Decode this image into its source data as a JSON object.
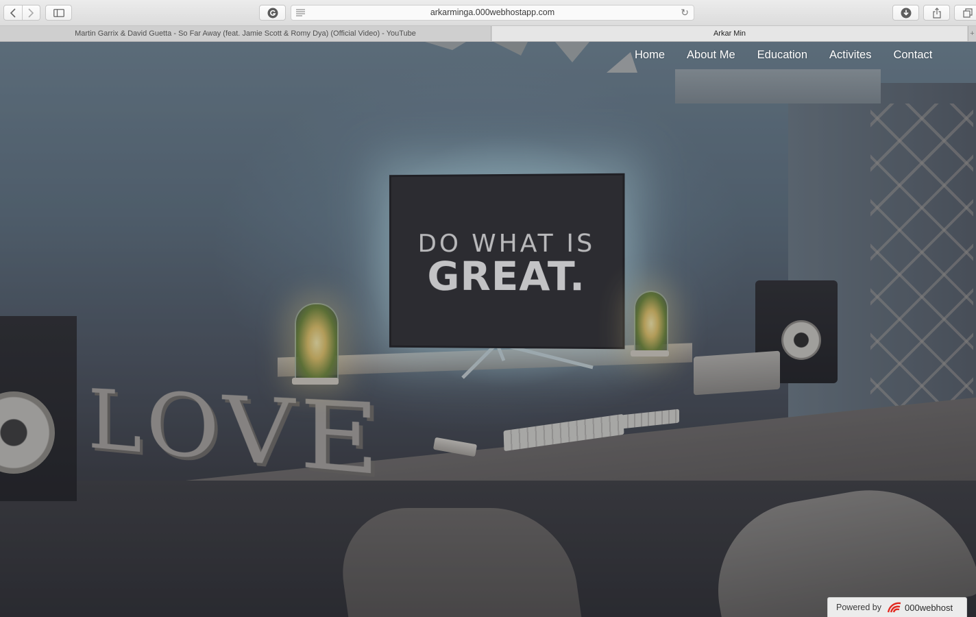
{
  "browser": {
    "url": "arkarminga.000webhostapp.com",
    "tabs": [
      {
        "label": "Martin Garrix & David Guetta - So Far Away (feat. Jamie Scott & Romy Dya) (Official Video) - YouTube",
        "active": false
      },
      {
        "label": "Arkar Min",
        "active": true
      }
    ],
    "icons": {
      "back": "chevron-left-icon",
      "forward": "chevron-right-icon",
      "sidebar": "sidebar-icon",
      "reader": "g-extension-icon",
      "reload": "reload-icon",
      "download": "download-icon",
      "share": "share-icon",
      "tabs": "tabs-overview-icon"
    }
  },
  "site": {
    "nav": [
      "Home",
      "About Me",
      "Education",
      "Activites",
      "Contact"
    ],
    "hero": {
      "line1": "DO WHAT IS",
      "line2": "GREAT.",
      "desk_letters": "LOVE"
    },
    "footer_badge": {
      "prefix": "Powered by",
      "brand": "000webhost",
      "logo_color": "#e2281f"
    }
  }
}
